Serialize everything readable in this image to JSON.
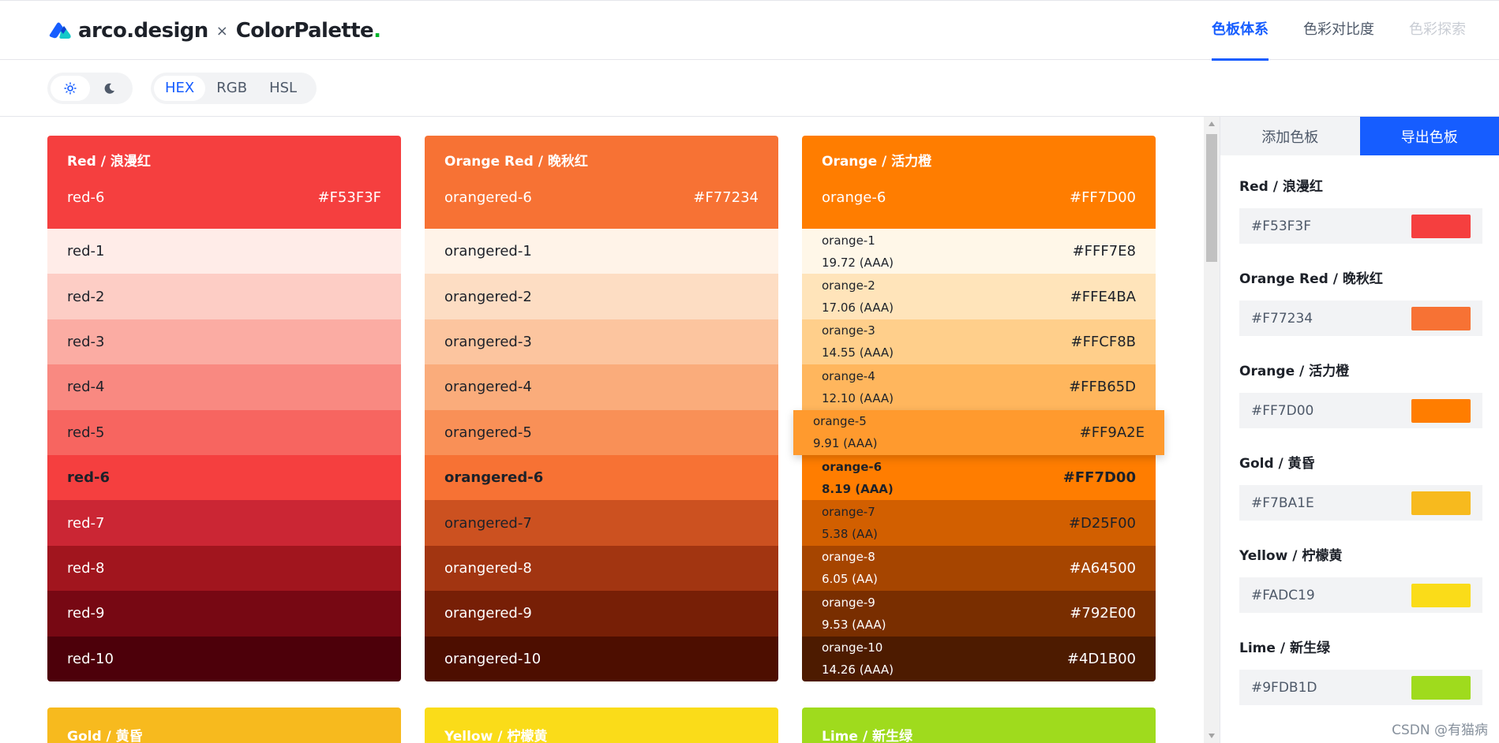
{
  "brand": {
    "name": "arco.design",
    "times": "×",
    "product": "ColorPalette",
    "dot": "."
  },
  "nav": [
    {
      "label": "色板体系",
      "state": "active"
    },
    {
      "label": "色彩对比度",
      "state": "normal"
    },
    {
      "label": "色彩探索",
      "state": "disabled"
    }
  ],
  "toolbar": {
    "theme_light_icon": "sun-icon",
    "theme_dark_icon": "moon-icon",
    "formats": [
      "HEX",
      "RGB",
      "HSL"
    ],
    "active_format": "HEX"
  },
  "palettes": [
    {
      "title": "Red / 浪漫红",
      "primary_name": "red-6",
      "primary_hex": "#F53F3F",
      "head_color": "#F53F3F",
      "rows": [
        {
          "name": "red-1",
          "bg": "#FFECE8",
          "fg": "#1d2129"
        },
        {
          "name": "red-2",
          "bg": "#FDCDC5",
          "fg": "#1d2129"
        },
        {
          "name": "red-3",
          "bg": "#FBACA3",
          "fg": "#1d2129"
        },
        {
          "name": "red-4",
          "bg": "#F98981",
          "fg": "#1d2129"
        },
        {
          "name": "red-5",
          "bg": "#F76560",
          "fg": "#1d2129"
        },
        {
          "name": "red-6",
          "bg": "#F53F3F",
          "fg": "#1d2129",
          "bold": true
        },
        {
          "name": "red-7",
          "bg": "#CB2634",
          "fg": "#ffffff"
        },
        {
          "name": "red-8",
          "bg": "#A1151E",
          "fg": "#ffffff"
        },
        {
          "name": "red-9",
          "bg": "#770813",
          "fg": "#ffffff"
        },
        {
          "name": "red-10",
          "bg": "#4D000A",
          "fg": "#ffffff"
        }
      ]
    },
    {
      "title": "Orange Red / 晚秋红",
      "primary_name": "orangered-6",
      "primary_hex": "#F77234",
      "head_color": "#F77234",
      "rows": [
        {
          "name": "orangered-1",
          "bg": "#FFF3E8",
          "fg": "#1d2129"
        },
        {
          "name": "orangered-2",
          "bg": "#FDDDC3",
          "fg": "#1d2129"
        },
        {
          "name": "orangered-3",
          "bg": "#FCC59F",
          "fg": "#1d2129"
        },
        {
          "name": "orangered-4",
          "bg": "#FAAC7B",
          "fg": "#1d2129"
        },
        {
          "name": "orangered-5",
          "bg": "#F99057",
          "fg": "#1d2129"
        },
        {
          "name": "orangered-6",
          "bg": "#F77234",
          "fg": "#1d2129",
          "bold": true
        },
        {
          "name": "orangered-7",
          "bg": "#CC5120",
          "fg": "#1d2129"
        },
        {
          "name": "orangered-8",
          "bg": "#A23511",
          "fg": "#ffffff"
        },
        {
          "name": "orangered-9",
          "bg": "#771F06",
          "fg": "#ffffff"
        },
        {
          "name": "orangered-10",
          "bg": "#4D0E00",
          "fg": "#ffffff"
        }
      ]
    },
    {
      "title": "Orange / 活力橙",
      "primary_name": "orange-6",
      "primary_hex": "#FF7D00",
      "head_color": "#FF7D00",
      "rows": [
        {
          "name": "orange-1",
          "meta": "19.72 (AAA)",
          "hex": "#FFF7E8",
          "bg": "#FFF7E8",
          "fg": "#1d2129"
        },
        {
          "name": "orange-2",
          "meta": "17.06 (AAA)",
          "hex": "#FFE4BA",
          "bg": "#FFE4BA",
          "fg": "#1d2129"
        },
        {
          "name": "orange-3",
          "meta": "14.55 (AAA)",
          "hex": "#FFCF8B",
          "bg": "#FFCF8B",
          "fg": "#1d2129"
        },
        {
          "name": "orange-4",
          "meta": "12.10 (AAA)",
          "hex": "#FFB65D",
          "bg": "#FFB65D",
          "fg": "#1d2129"
        },
        {
          "name": "orange-5",
          "meta": "9.91 (AAA)",
          "hex": "#FF9A2E",
          "bg": "#FF9A2E",
          "fg": "#1d2129",
          "hover": true
        },
        {
          "name": "orange-6",
          "meta": "8.19 (AAA)",
          "hex": "#FF7D00",
          "bg": "#FF7D00",
          "fg": "#1d2129",
          "bold": true
        },
        {
          "name": "orange-7",
          "meta": "5.38 (AA)",
          "hex": "#D25F00",
          "bg": "#D25F00",
          "fg": "#1d2129"
        },
        {
          "name": "orange-8",
          "meta": "6.05 (AA)",
          "hex": "#A64500",
          "bg": "#A64500",
          "fg": "#ffffff"
        },
        {
          "name": "orange-9",
          "meta": "9.53 (AAA)",
          "hex": "#792E00",
          "bg": "#792E00",
          "fg": "#ffffff"
        },
        {
          "name": "orange-10",
          "meta": "14.26 (AAA)",
          "hex": "#4D1B00",
          "bg": "#4D1B00",
          "fg": "#ffffff"
        }
      ]
    }
  ],
  "next_palettes": [
    {
      "title": "Gold / 黄昏",
      "color": "#F7BA1E"
    },
    {
      "title": "Yellow / 柠檬黄",
      "color": "#FADC19"
    },
    {
      "title": "Lime / 新生绿",
      "color": "#9FDB1D"
    }
  ],
  "side": {
    "tabs": [
      "添加色板",
      "导出色板"
    ],
    "active_tab": "导出色板",
    "items": [
      {
        "label": "Red / 浪漫红",
        "hex": "#F53F3F"
      },
      {
        "label": "Orange Red / 晚秋红",
        "hex": "#F77234"
      },
      {
        "label": "Orange / 活力橙",
        "hex": "#FF7D00"
      },
      {
        "label": "Gold / 黄昏",
        "hex": "#F7BA1E"
      },
      {
        "label": "Yellow / 柠檬黄",
        "hex": "#FADC19"
      },
      {
        "label": "Lime / 新生绿",
        "hex": "#9FDB1D"
      }
    ]
  },
  "watermark": "CSDN @有猫病"
}
